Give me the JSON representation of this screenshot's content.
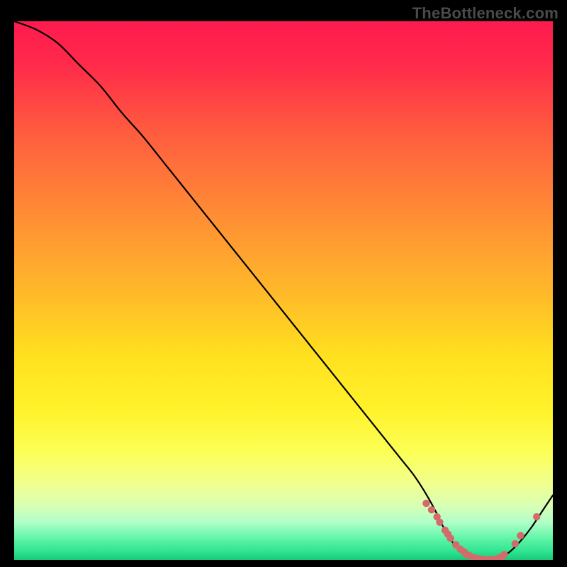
{
  "watermark": "TheBottleneck.com",
  "chart_data": {
    "type": "line",
    "title": "",
    "xlabel": "",
    "ylabel": "",
    "xlim": [
      0,
      100
    ],
    "ylim": [
      0,
      100
    ],
    "series": [
      {
        "name": "bottleneck-curve",
        "x": [
          0,
          4,
          8,
          12,
          16,
          20,
          24,
          28,
          32,
          36,
          40,
          44,
          48,
          52,
          56,
          60,
          64,
          68,
          70,
          72,
          74,
          76,
          78,
          80,
          82,
          84,
          86,
          88,
          90,
          92,
          94,
          96,
          98,
          100
        ],
        "y": [
          100,
          98.5,
          96,
          92,
          88,
          83,
          78.5,
          73.5,
          68.5,
          63.5,
          58.5,
          53.5,
          48.5,
          43.5,
          38.5,
          33.5,
          28.5,
          23.5,
          21,
          18.5,
          16,
          13,
          9.5,
          5.5,
          2.5,
          1,
          0.2,
          0,
          0.3,
          1.5,
          3.5,
          6,
          9,
          12
        ]
      }
    ],
    "markers": {
      "name": "highlight-dots",
      "color": "#d46a6a",
      "x": [
        76.5,
        77.5,
        78.5,
        79,
        80,
        80.5,
        81,
        82,
        82.8,
        83.5,
        84,
        84.5,
        85.5,
        86,
        86.5,
        87,
        88,
        88.5,
        89,
        90,
        90.5,
        91,
        93,
        94,
        97
      ],
      "y": [
        10.5,
        9.3,
        8,
        7,
        5.5,
        4.8,
        4,
        2.8,
        2,
        1.5,
        1,
        0.8,
        0.4,
        0.2,
        0.15,
        0.1,
        0.05,
        0.05,
        0.1,
        0.3,
        0.6,
        1.0,
        3,
        4.5,
        8
      ]
    },
    "background_gradient": {
      "stops": [
        {
          "offset": 0.0,
          "color": "#ff1a4f"
        },
        {
          "offset": 0.08,
          "color": "#ff2a4a"
        },
        {
          "offset": 0.2,
          "color": "#ff5a3f"
        },
        {
          "offset": 0.35,
          "color": "#ff8a35"
        },
        {
          "offset": 0.5,
          "color": "#ffb82a"
        },
        {
          "offset": 0.62,
          "color": "#ffe01f"
        },
        {
          "offset": 0.72,
          "color": "#fff22a"
        },
        {
          "offset": 0.8,
          "color": "#fcff55"
        },
        {
          "offset": 0.86,
          "color": "#f0ff90"
        },
        {
          "offset": 0.9,
          "color": "#d8ffb5"
        },
        {
          "offset": 0.93,
          "color": "#b0ffc8"
        },
        {
          "offset": 0.96,
          "color": "#60f5a8"
        },
        {
          "offset": 0.985,
          "color": "#2de38f"
        },
        {
          "offset": 1.0,
          "color": "#18c878"
        }
      ]
    }
  }
}
